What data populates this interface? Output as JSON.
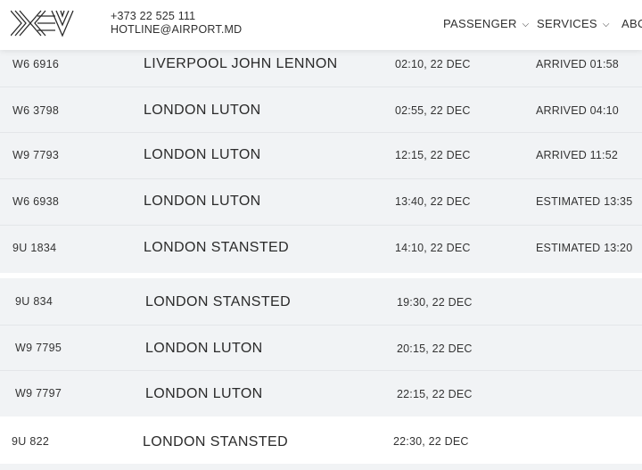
{
  "header": {
    "phone": "+373 22 525 111",
    "email": "HOTLINE@AIRPORT.MD",
    "nav": [
      {
        "label": "PASSENGER"
      },
      {
        "label": "SERVICES"
      },
      {
        "label": "ABOUT"
      }
    ]
  },
  "flights": [
    {
      "flight": "W6 6916",
      "destination": "LIVERPOOL JOHN LENNON",
      "time": "02:10, 22 DEC",
      "status": "ARRIVED 01:58"
    },
    {
      "flight": "W6 3798",
      "destination": "LONDON LUTON",
      "time": "02:55, 22 DEC",
      "status": "ARRIVED 04:10"
    },
    {
      "flight": "W9 7793",
      "destination": "LONDON LUTON",
      "time": "12:15, 22 DEC",
      "status": "ARRIVED 11:52"
    },
    {
      "flight": "W6 6938",
      "destination": "LONDON LUTON",
      "time": "13:40, 22 DEC",
      "status": "ESTIMATED 13:35"
    },
    {
      "flight": "9U 1834",
      "destination": "LONDON STANSTED",
      "time": "14:10, 22 DEC",
      "status": "ESTIMATED 13:20"
    },
    {
      "flight": "9U 834",
      "destination": "LONDON STANSTED",
      "time": "19:30, 22 DEC",
      "status": ""
    },
    {
      "flight": "W9 7795",
      "destination": "LONDON LUTON",
      "time": "20:15, 22 DEC",
      "status": ""
    },
    {
      "flight": "W9 7797",
      "destination": "LONDON LUTON",
      "time": "22:15, 22 DEC",
      "status": ""
    },
    {
      "flight": "9U 822",
      "destination": "LONDON STANSTED",
      "time": "22:30, 22 DEC",
      "status": ""
    }
  ]
}
